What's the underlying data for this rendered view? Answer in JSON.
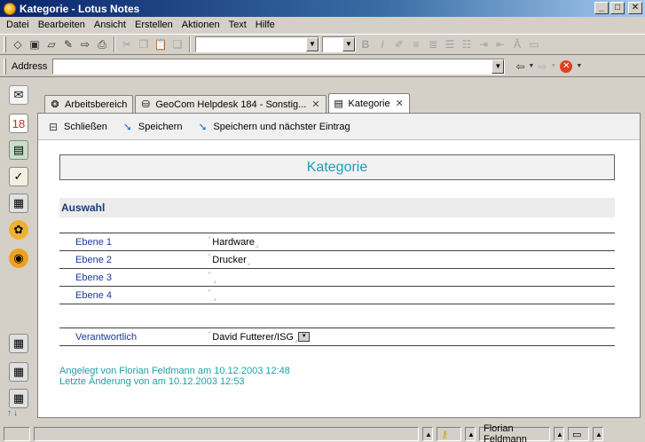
{
  "window": {
    "title": "Kategorie - Lotus Notes"
  },
  "menu": [
    "Datei",
    "Bearbeiten",
    "Ansicht",
    "Erstellen",
    "Aktionen",
    "Text",
    "Hilfe"
  ],
  "address": {
    "label": "Address",
    "value": ""
  },
  "tabs": [
    {
      "label": "Arbeitsbereich",
      "icon": "workspace-icon"
    },
    {
      "label": "GeoCom Helpdesk 184 - Sonstig...",
      "icon": "database-icon"
    },
    {
      "label": "Kategorie",
      "icon": "form-icon"
    }
  ],
  "actions": [
    {
      "label": "Schließen",
      "icon": "close-document-icon"
    },
    {
      "label": "Speichern",
      "icon": "save-icon"
    },
    {
      "label": "Speichern und nächster Eintrag",
      "icon": "save-next-icon"
    }
  ],
  "form": {
    "title": "Kategorie",
    "section_title": "Auswahl",
    "fields": [
      {
        "label": "Ebene 1",
        "value": "Hardware"
      },
      {
        "label": "Ebene 2",
        "value": "Drucker"
      },
      {
        "label": "Ebene 3",
        "value": ""
      },
      {
        "label": "Ebene 4",
        "value": ""
      }
    ],
    "responsible": {
      "label": "Verantwortlich",
      "value": "David Futterer/ISG"
    },
    "created": "Angelegt von  Florian Feldmann am 10.12.2003 12:48",
    "modified": "Letzte Änderung von  am 10.12.2003 12:53"
  },
  "status": {
    "user": "Florian Feldmann"
  },
  "colors": {
    "title_bar": "#0a246a",
    "accent_teal": "#1aa0b8",
    "label_blue": "#1a3a9a"
  }
}
